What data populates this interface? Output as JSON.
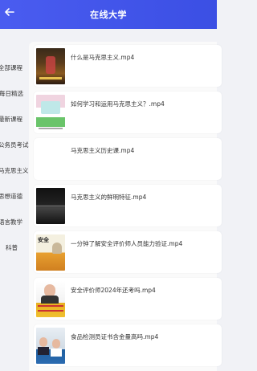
{
  "header": {
    "title": "在线大学"
  },
  "sidebar": {
    "categories": [
      {
        "label": "全部课程"
      },
      {
        "label": "每日精选"
      },
      {
        "label": "最新课程"
      },
      {
        "label": "公务员考试"
      },
      {
        "label": "马克思主义"
      },
      {
        "label": "思想道德"
      },
      {
        "label": "语言教学"
      },
      {
        "label": "科普"
      }
    ]
  },
  "videos": [
    {
      "title": "什么是马克思主义.mp4",
      "thumb_icon": "lecture-stage-thumbnail"
    },
    {
      "title": "如何学习和运用马克思主义？.mp4",
      "thumb_icon": "green-slide-thumbnail"
    },
    {
      "title": "马克思主义历史课.mp4",
      "thumb_icon": "blank-thumbnail"
    },
    {
      "title": "马克思主义的鲜明特征.mp4",
      "thumb_icon": "dark-screen-thumbnail"
    },
    {
      "title": "一分钟了解安全评价师人员能力验证.mp4",
      "thumb_icon": "safety-poster-thumbnail",
      "thumb_label": "安全"
    },
    {
      "title": "安全评价师2024年还考吗.mp4",
      "thumb_icon": "presenter-thumbnail"
    },
    {
      "title": "食品检测员证书含金量高吗.mp4",
      "thumb_icon": "office-scene-thumbnail"
    }
  ],
  "colors": {
    "header": "#3b4fe4",
    "background": "#f1f2f6"
  }
}
